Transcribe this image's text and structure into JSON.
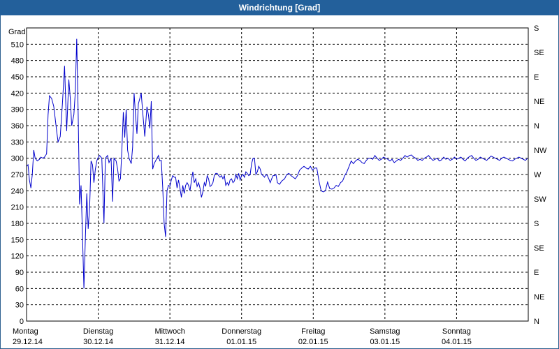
{
  "window": {
    "title": "Windrichtung [Grad]"
  },
  "chart_data": {
    "type": "line",
    "title": "Windrichtung [Grad]",
    "ylabel": "Grad",
    "ylim": [
      0,
      540
    ],
    "yticks": [
      0,
      30,
      60,
      90,
      120,
      150,
      180,
      210,
      240,
      270,
      300,
      330,
      360,
      390,
      420,
      450,
      480,
      510
    ],
    "right_axis_labels": [
      {
        "deg": 0,
        "label": "N"
      },
      {
        "deg": 45,
        "label": "NE"
      },
      {
        "deg": 90,
        "label": "E"
      },
      {
        "deg": 135,
        "label": "SE"
      },
      {
        "deg": 180,
        "label": "S"
      },
      {
        "deg": 225,
        "label": "SW"
      },
      {
        "deg": 270,
        "label": "W"
      },
      {
        "deg": 315,
        "label": "NW"
      },
      {
        "deg": 360,
        "label": "N"
      },
      {
        "deg": 405,
        "label": "NE"
      },
      {
        "deg": 450,
        "label": "E"
      },
      {
        "deg": 495,
        "label": "SE"
      },
      {
        "deg": 540,
        "label": "S"
      }
    ],
    "xlim": [
      0,
      7
    ],
    "day_ticks": [
      {
        "day": "Montag",
        "date": "29.12.14"
      },
      {
        "day": "Dienstag",
        "date": "30.12.14"
      },
      {
        "day": "Mittwoch",
        "date": "31.12.14"
      },
      {
        "day": "Donnerstag",
        "date": "01.01.15"
      },
      {
        "day": "Freitag",
        "date": "02.01.15"
      },
      {
        "day": "Samstag",
        "date": "03.01.15"
      },
      {
        "day": "Sonntag",
        "date": "04.01.15"
      }
    ],
    "grid": true,
    "line_color": "#0000cc",
    "series": [
      {
        "x": [
          0.0,
          0.02,
          0.04,
          0.06,
          0.08,
          0.1,
          0.12,
          0.15,
          0.18,
          0.2,
          0.23,
          0.25,
          0.28,
          0.3,
          0.32,
          0.35,
          0.38,
          0.42,
          0.44,
          0.47,
          0.5,
          0.53,
          0.56,
          0.59,
          0.61,
          0.63,
          0.66,
          0.68,
          0.7,
          0.72,
          0.74,
          0.76,
          0.78,
          0.8,
          0.82,
          0.84,
          0.86,
          0.88,
          0.9,
          0.92,
          0.94,
          0.96,
          0.98,
          1.0,
          1.02,
          1.05,
          1.08,
          1.1,
          1.13,
          1.15,
          1.18,
          1.2,
          1.22,
          1.25,
          1.27,
          1.29,
          1.31,
          1.33,
          1.35,
          1.37,
          1.39,
          1.41,
          1.43,
          1.46,
          1.48,
          1.5,
          1.52,
          1.54,
          1.56,
          1.58,
          1.6,
          1.62,
          1.65,
          1.68,
          1.7,
          1.72,
          1.74,
          1.76,
          1.78,
          1.8,
          1.82,
          1.84,
          1.86,
          1.88,
          1.9,
          1.92,
          1.94,
          1.96,
          1.98,
          2.0,
          2.02,
          2.04,
          2.06,
          2.08,
          2.1,
          2.12,
          2.14,
          2.16,
          2.18,
          2.2,
          2.22,
          2.24,
          2.26,
          2.28,
          2.3,
          2.32,
          2.34,
          2.36,
          2.38,
          2.4,
          2.42,
          2.44,
          2.46,
          2.48,
          2.5,
          2.52,
          2.54,
          2.56,
          2.58,
          2.6,
          2.62,
          2.64,
          2.66,
          2.68,
          2.7,
          2.72,
          2.74,
          2.76,
          2.78,
          2.8,
          2.82,
          2.84,
          2.86,
          2.88,
          2.9,
          2.92,
          2.94,
          2.96,
          2.98,
          3.0,
          3.02,
          3.04,
          3.06,
          3.08,
          3.1,
          3.12,
          3.14,
          3.16,
          3.18,
          3.2,
          3.22,
          3.24,
          3.26,
          3.28,
          3.3,
          3.32,
          3.34,
          3.36,
          3.38,
          3.4,
          3.42,
          3.44,
          3.46,
          3.48,
          3.5,
          3.53,
          3.56,
          3.6,
          3.63,
          3.66,
          3.69,
          3.72,
          3.75,
          3.78,
          3.81,
          3.84,
          3.87,
          3.9,
          3.93,
          3.96,
          3.99,
          4.02,
          4.05,
          4.08,
          4.11,
          4.14,
          4.17,
          4.2,
          4.23,
          4.26,
          4.29,
          4.32,
          4.35,
          4.38,
          4.41,
          4.44,
          4.47,
          4.5,
          4.53,
          4.56,
          4.59,
          4.62,
          4.65,
          4.68,
          4.71,
          4.74,
          4.77,
          4.8,
          4.83,
          4.86,
          4.89,
          4.92,
          4.95,
          4.98,
          5.01,
          5.04,
          5.07,
          5.1,
          5.13,
          5.16,
          5.19,
          5.22,
          5.25,
          5.28,
          5.31,
          5.34,
          5.37,
          5.4,
          5.43,
          5.46,
          5.49,
          5.52,
          5.55,
          5.58,
          5.61,
          5.64,
          5.67,
          5.7,
          5.73,
          5.76,
          5.79,
          5.82,
          5.85,
          5.88,
          5.91,
          5.94,
          5.97,
          6.0,
          6.03,
          6.06,
          6.09,
          6.12,
          6.15,
          6.18,
          6.21,
          6.24,
          6.27,
          6.3,
          6.33,
          6.36,
          6.39,
          6.42,
          6.45,
          6.48,
          6.51,
          6.54,
          6.57,
          6.6,
          6.63,
          6.66,
          6.69,
          6.72,
          6.75,
          6.78,
          6.81,
          6.84,
          6.87,
          6.9,
          6.93,
          6.96,
          6.99
        ],
        "values": [
          285,
          288,
          260,
          245,
          270,
          315,
          300,
          295,
          298,
          302,
          300,
          302,
          308,
          380,
          415,
          410,
          395,
          350,
          330,
          340,
          400,
          470,
          350,
          445,
          410,
          360,
          380,
          420,
          520,
          380,
          215,
          250,
          160,
          60,
          150,
          235,
          170,
          210,
          295,
          288,
          255,
          280,
          295,
          302,
          305,
          300,
          180,
          300,
          305,
          292,
          300,
          220,
          300,
          295,
          280,
          258,
          262,
          315,
          385,
          338,
          390,
          315,
          300,
          290,
          320,
          420,
          380,
          345,
          400,
          410,
          420,
          385,
          340,
          395,
          380,
          355,
          405,
          280,
          290,
          295,
          300,
          305,
          295,
          296,
          245,
          180,
          155,
          240,
          250,
          248,
          260,
          268,
          265,
          265,
          245,
          260,
          245,
          228,
          250,
          235,
          250,
          255,
          250,
          240,
          258,
          275,
          255,
          262,
          248,
          255,
          245,
          228,
          238,
          255,
          248,
          268,
          262,
          248,
          250,
          255,
          268,
          272,
          272,
          268,
          265,
          268,
          262,
          268,
          250,
          255,
          250,
          260,
          262,
          255,
          258,
          270,
          262,
          272,
          260,
          268,
          270,
          265,
          275,
          272,
          268,
          270,
          290,
          300,
          300,
          270,
          275,
          285,
          280,
          270,
          268,
          265,
          270,
          268,
          262,
          255,
          262,
          268,
          268,
          270,
          255,
          252,
          258,
          262,
          270,
          272,
          268,
          265,
          262,
          268,
          278,
          282,
          285,
          282,
          280,
          285,
          278,
          282,
          282,
          258,
          240,
          238,
          240,
          256,
          244,
          243,
          245,
          250,
          248,
          255,
          258,
          268,
          275,
          285,
          295,
          290,
          295,
          298,
          296,
          292,
          290,
          296,
          300,
          300,
          298,
          305,
          300,
          296,
          298,
          302,
          300,
          298,
          295,
          298,
          292,
          295,
          298,
          296,
          300,
          305,
          302,
          305,
          306,
          302,
          300,
          296,
          298,
          296,
          300,
          302,
          305,
          300,
          296,
          298,
          300,
          295,
          297,
          302,
          298,
          300,
          296,
          298,
          302,
          298,
          300,
          302,
          298,
          295,
          300,
          303,
          305,
          300,
          296,
          298,
          302,
          300,
          298,
          296,
          300,
          304,
          302,
          300,
          298,
          296,
          300,
          302,
          300,
          298,
          296,
          295,
          298,
          300,
          302,
          300,
          298,
          296,
          300
        ]
      }
    ]
  }
}
